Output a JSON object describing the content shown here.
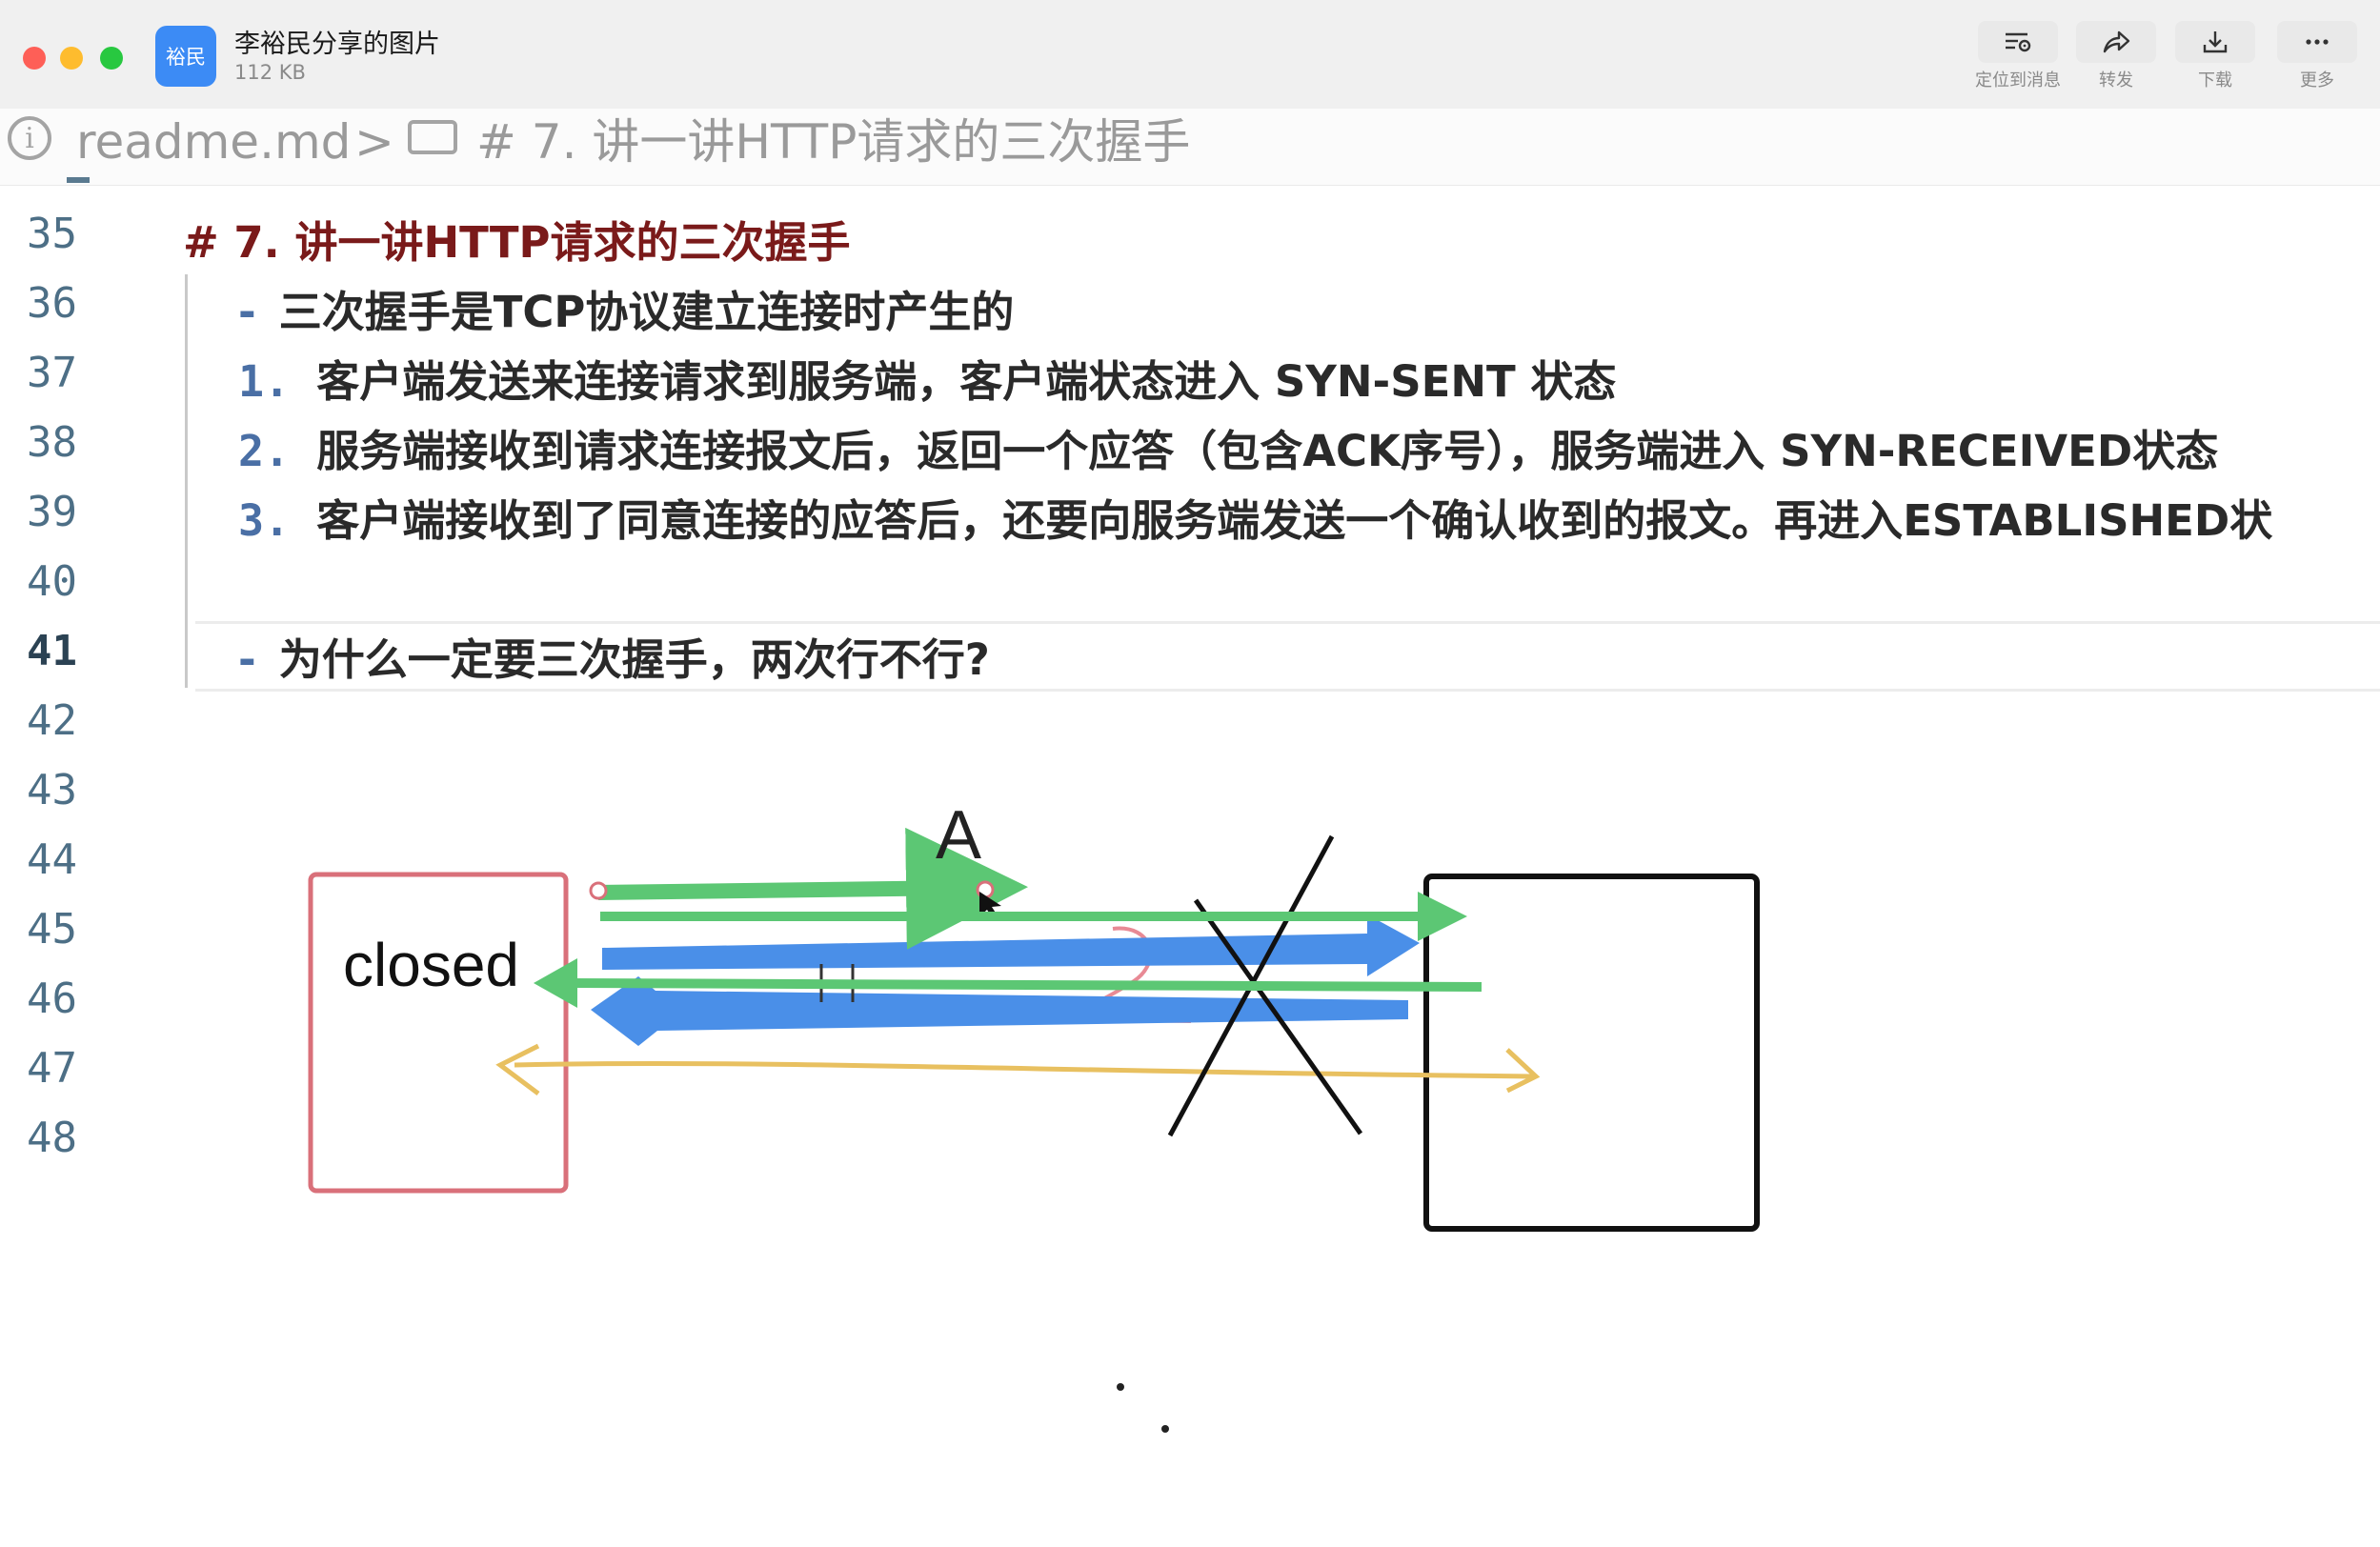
{
  "window": {
    "app_icon_text": "裕民",
    "title": "李裕民分享的图片",
    "file_size": "112 KB",
    "toolbar": [
      {
        "label": "定位到消息",
        "icon": "locate-message-icon"
      },
      {
        "label": "转发",
        "icon": "forward-icon"
      },
      {
        "label": "下载",
        "icon": "download-icon"
      },
      {
        "label": "更多",
        "icon": "more-icon"
      }
    ]
  },
  "breadcrumb": {
    "file": "readme.md",
    "separator": ">",
    "heading": "# 7. 讲一讲HTTP请求的三次握手"
  },
  "editor": {
    "line_numbers": [
      "35",
      "36",
      "37",
      "38",
      "39",
      "40",
      "41",
      "42",
      "43",
      "44",
      "45",
      "46",
      "47",
      "48"
    ],
    "lines": {
      "l35": "# 7. 讲一讲HTTP请求的三次握手",
      "l36_marker": "-",
      "l36": "三次握手是TCP协议建立连接时产生的",
      "l37_num": "1.",
      "l37": "客户端发送来连接请求到服务端，客户端状态进入 SYN-SENT 状态",
      "l38_num": "2.",
      "l38": "服务端接收到请求连接报文后，返回一个应答（包含ACK序号），服务端进入 SYN-RECEIVED状态",
      "l39_num": "3.",
      "l39": "客户端接收到了同意连接的应答后，还要向服务端发送一个确认收到的报文。再进入ESTABLISHED状",
      "l41_marker": "-",
      "l41": "为什么一定要三次握手，两次行不行?"
    }
  },
  "diagram": {
    "client_label": "closed",
    "arrow_label": "A",
    "colors": {
      "client_box": "#d9707a",
      "server_box": "#111111",
      "green_arrow": "#5cc774",
      "blue_arrow": "#4a8fe8",
      "yellow_arrow": "#e8c060",
      "cross": "#111111",
      "pink_scribble": "#e88a95"
    }
  }
}
